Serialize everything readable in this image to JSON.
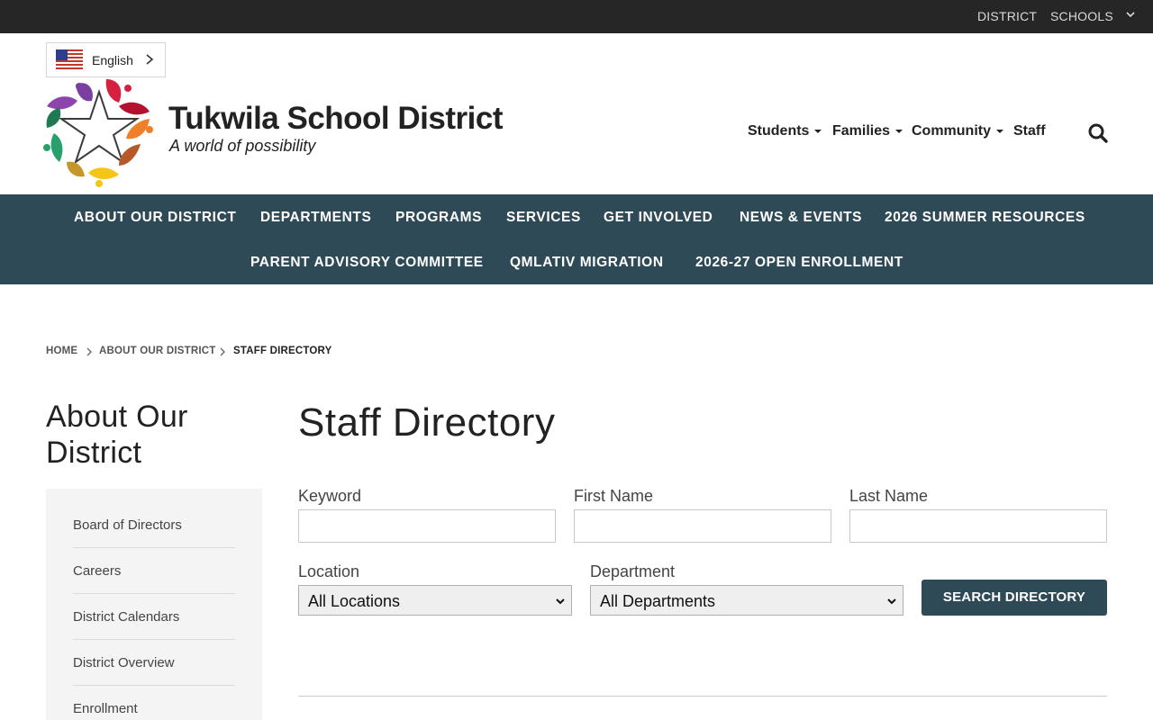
{
  "topbar": {
    "district_label": "DISTRICT",
    "schools_label": "SCHOOLS",
    "background": "#262626"
  },
  "language": {
    "selected": "English",
    "flag_icon": "us-flag-icon"
  },
  "header": {
    "title": "Tukwila School District",
    "tagline": "A world of possibility",
    "audience_nav": [
      {
        "label": "Students",
        "has_menu": true
      },
      {
        "label": "Families",
        "has_menu": true
      },
      {
        "label": "Community",
        "has_menu": true
      },
      {
        "label": "Staff",
        "has_menu": false
      }
    ],
    "search_icon": "search-icon"
  },
  "main_nav": {
    "background": "#2f4a57",
    "row1": [
      "ABOUT OUR DISTRICT",
      "DEPARTMENTS",
      "PROGRAMS",
      "SERVICES",
      "GET INVOLVED",
      "NEWS & EVENTS",
      "2026 SUMMER RESOURCES"
    ],
    "row2": [
      "PARENT ADVISORY COMMITTEE",
      "QMLATIV MIGRATION",
      "2026-27 OPEN ENROLLMENT"
    ]
  },
  "breadcrumb": [
    "HOME",
    "ABOUT OUR DISTRICT",
    "STAFF DIRECTORY"
  ],
  "sidebar": {
    "title_line1": "About Our",
    "title_line2": "District",
    "items": [
      "Board of Directors",
      "Careers",
      "District Calendars",
      "District Overview",
      "Enrollment"
    ]
  },
  "main": {
    "title": "Staff Directory",
    "keyword_label": "Keyword",
    "keyword_value": "",
    "first_name_label": "First Name",
    "first_name_value": "",
    "last_name_label": "Last Name",
    "last_name_value": "",
    "location_label": "Location",
    "location_selected": "All Locations",
    "department_label": "Department",
    "department_selected": "All Departments",
    "search_button": "SEARCH DIRECTORY"
  }
}
